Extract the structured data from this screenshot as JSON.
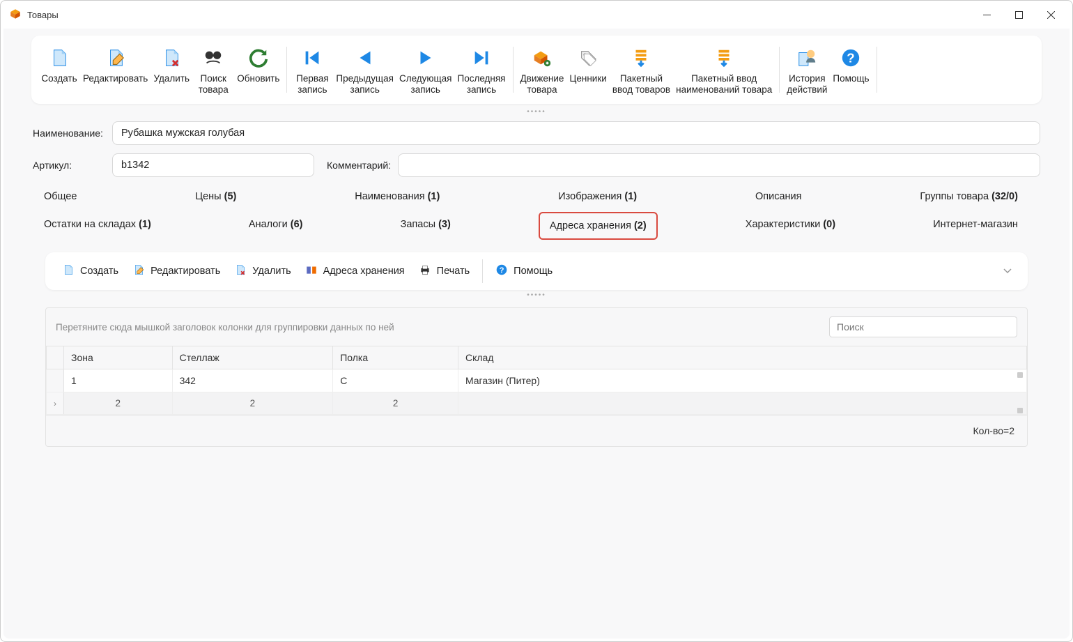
{
  "titlebar": {
    "title": "Товары"
  },
  "toolbar": [
    {
      "name": "create",
      "label": "Создать"
    },
    {
      "name": "edit",
      "label": "Редактировать"
    },
    {
      "name": "delete",
      "label": "Удалить"
    },
    {
      "name": "search",
      "label": "Поиск\nтовара"
    },
    {
      "name": "refresh",
      "label": "Обновить"
    },
    {
      "name": "first",
      "label": "Первая\nзапись"
    },
    {
      "name": "prev",
      "label": "Предыдущая\nзапись"
    },
    {
      "name": "next",
      "label": "Следующая\nзапись"
    },
    {
      "name": "last",
      "label": "Последняя\nзапись"
    },
    {
      "name": "movement",
      "label": "Движение\nтовара"
    },
    {
      "name": "pricetags",
      "label": "Ценники"
    },
    {
      "name": "batch-goods",
      "label": "Пакетный\nввод товаров"
    },
    {
      "name": "batch-names",
      "label": "Пакетный ввод\nнаименований товара"
    },
    {
      "name": "history",
      "label": "История\nдействий"
    },
    {
      "name": "help",
      "label": "Помощь"
    }
  ],
  "form": {
    "labels": {
      "name": "Наименование:",
      "article": "Артикул:",
      "comment": "Комментарий:"
    },
    "values": {
      "name": "Рубашка мужская голубая",
      "article": "b1342",
      "comment": ""
    }
  },
  "tabs": {
    "row1": [
      {
        "name": "general",
        "label": "Общее"
      },
      {
        "name": "prices",
        "label": "Цены (5)"
      },
      {
        "name": "names",
        "label": "Наименования (1)"
      },
      {
        "name": "images",
        "label": "Изображения (1)"
      },
      {
        "name": "descriptions",
        "label": "Описания"
      },
      {
        "name": "groups",
        "label": "Группы товара (32/0)"
      }
    ],
    "row2": [
      {
        "name": "stock",
        "label": "Остатки на складах (1)"
      },
      {
        "name": "analogs",
        "label": "Аналоги (6)"
      },
      {
        "name": "reserves",
        "label": "Запасы (3)"
      },
      {
        "name": "storage",
        "label": "Адреса хранения (2)",
        "active": true
      },
      {
        "name": "attrs",
        "label": "Характеристики (0)"
      },
      {
        "name": "eshop",
        "label": "Интернет-магазин"
      }
    ]
  },
  "sub_toolbar": [
    {
      "name": "create",
      "label": "Создать"
    },
    {
      "name": "edit",
      "label": "Редактировать"
    },
    {
      "name": "delete",
      "label": "Удалить"
    },
    {
      "name": "storage",
      "label": "Адреса хранения"
    },
    {
      "name": "print",
      "label": "Печать"
    },
    {
      "name": "help",
      "label": "Помощь"
    }
  ],
  "grid": {
    "group_hint": "Перетяните сюда мышкой заголовок колонки для группировки данных по ней",
    "search_placeholder": "Поиск",
    "columns": [
      "Зона",
      "Стеллаж",
      "Полка",
      "Склад"
    ],
    "rows": [
      {
        "zone": "1",
        "rack": "342",
        "shelf": "C",
        "warehouse": "Магазин (Питер)"
      }
    ],
    "summary": [
      "2",
      "2",
      "2",
      ""
    ],
    "footer": "Кол-во=2"
  }
}
